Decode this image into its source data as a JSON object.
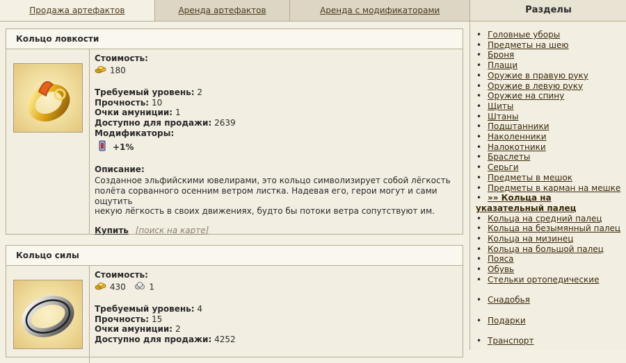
{
  "tabs": [
    {
      "label": "Продажа артефактов",
      "active": true
    },
    {
      "label": "Аренда артефактов",
      "active": false
    },
    {
      "label": "Аренда с модификаторами",
      "active": false
    }
  ],
  "sections_title": "Разделы",
  "sections": [
    {
      "label": "Головные уборы"
    },
    {
      "label": "Предметы на шею"
    },
    {
      "label": "Броня"
    },
    {
      "label": "Плащи"
    },
    {
      "label": "Оружие в правую руку"
    },
    {
      "label": "Оружие в левую руку"
    },
    {
      "label": "Оружие на спину"
    },
    {
      "label": "Щиты"
    },
    {
      "label": "Штаны"
    },
    {
      "label": "Подштанники"
    },
    {
      "label": "Наколенники"
    },
    {
      "label": "Налокотники"
    },
    {
      "label": "Браслеты"
    },
    {
      "label": "Серьги"
    },
    {
      "label": "Предметы в мешок"
    },
    {
      "label": "Предметы в карман на мешке"
    },
    {
      "label_line1": "»» Кольца на",
      "label_line2": "указательный палец",
      "current": true
    },
    {
      "label": "Кольца на средний палец"
    },
    {
      "label": "Кольца на безымянный палец"
    },
    {
      "label": "Кольца на мизинец"
    },
    {
      "label": "Кольца на большой палец"
    },
    {
      "label": "Пояса"
    },
    {
      "label": "Обувь"
    },
    {
      "label": "Стельки ортопедические"
    },
    {
      "label": "Снадобья",
      "gap": true
    },
    {
      "label": "Подарки",
      "gap": true
    },
    {
      "label": "Транспорт",
      "gap": true
    }
  ],
  "labels": {
    "cost": "Стоимость:",
    "level": "Требуемый уровень:",
    "durability": "Прочность:",
    "ammo": "Очки амуниции:",
    "available": "Доступно для продажи:",
    "modifiers": "Модификаторы:",
    "description": "Описание:",
    "buy": "Купить",
    "map": "[поиск на карте]"
  },
  "items": [
    {
      "title": "Кольцо ловкости",
      "gold": "180",
      "level": "2",
      "durability": "10",
      "ammo": "1",
      "available": "2639",
      "modifier": "+1%",
      "description_lines": [
        "Созданное эльфийскими ювелирами, это кольцо символизирует собой лёгкость",
        "полёта сорванного осенним ветром листка. Надевая его, герои могут и сами ощутить",
        "некую лёгкость в своих движениях, будто бы потоки ветра сопутствуют им."
      ]
    },
    {
      "title": "Кольцо силы",
      "gold": "430",
      "silver": "1",
      "level": "4",
      "durability": "15",
      "ammo": "2",
      "available": "4252"
    }
  ]
}
